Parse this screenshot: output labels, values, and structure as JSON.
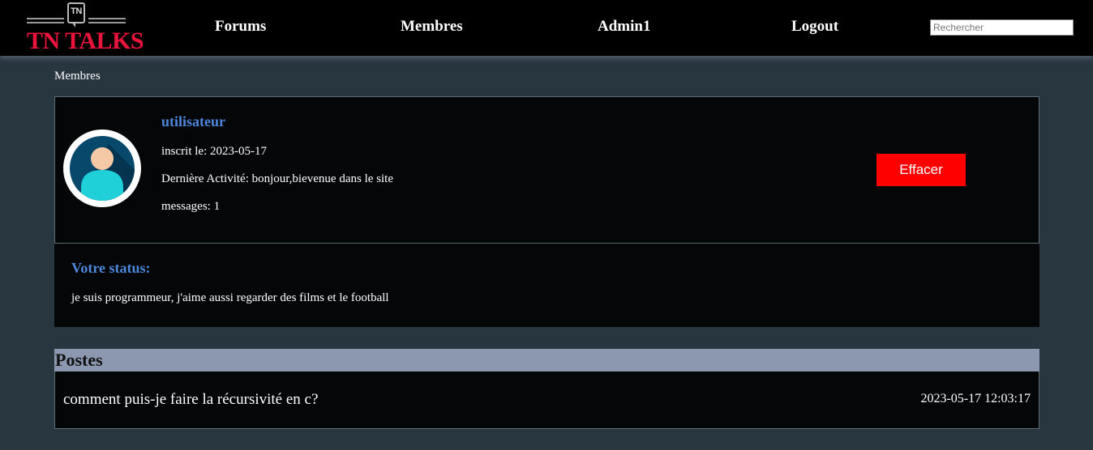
{
  "header": {
    "logo_badge": "TN",
    "logo_text": "TN TALKS",
    "nav": {
      "forums": "Forums",
      "membres": "Membres",
      "admin": "Admin1",
      "logout": "Logout"
    },
    "search": {
      "placeholder": "Rechercher",
      "value": ""
    }
  },
  "breadcrumb": "Membres",
  "profile": {
    "username": "utilisateur",
    "joined": "inscrit le: 2023-05-17",
    "last_activity": "Dernière Activité: bonjour,bievenue dans le site",
    "messages": "messages: 1",
    "delete_label": "Effacer"
  },
  "status": {
    "title": "Votre status:",
    "text": "je suis programmeur, j'aime aussi regarder des films et le football"
  },
  "posts": {
    "title": "Postes",
    "items": [
      {
        "title": "comment puis-je faire la récursivité en c?",
        "date": "2023-05-17 12:03:17"
      }
    ]
  },
  "colors": {
    "accent": "#4d86da",
    "danger": "#ff0000",
    "logo": "#e8143c",
    "page_bg": "#283640",
    "card_bg": "#050608",
    "posts_header_bg": "#8b98b0"
  }
}
